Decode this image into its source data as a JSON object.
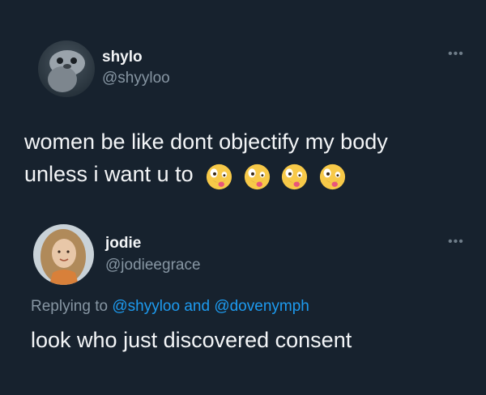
{
  "tweet1": {
    "name": "shylo",
    "handle": "@shyyloo",
    "more": "•••",
    "text_line1": "women be like dont objectify my body",
    "text_line2": "unless i want u to",
    "emojis": [
      "zany-face-icon",
      "zany-face-icon",
      "zany-face-icon",
      "zany-face-icon"
    ]
  },
  "tweet2": {
    "name": "jodie",
    "handle": "@jodieegrace",
    "more": "•••",
    "replying_prefix": "Replying to ",
    "mention1": "@shyyloo",
    "replying_and": " and ",
    "mention2": "@dovenymph",
    "text": "look who just discovered consent"
  },
  "colors": {
    "background": "#17222e",
    "text": "#f3f5f7",
    "muted": "#8796a3",
    "link": "#1d9bf0"
  }
}
